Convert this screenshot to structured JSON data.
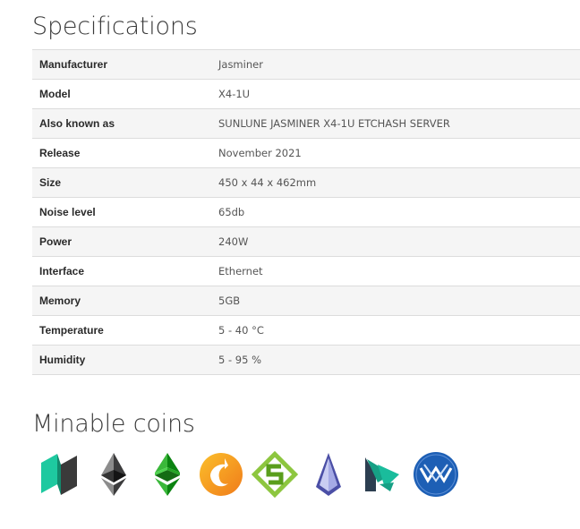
{
  "specifications": {
    "title": "Specifications",
    "rows": [
      {
        "key": "Manufacturer",
        "value": "Jasminer"
      },
      {
        "key": "Model",
        "value": "X4-1U"
      },
      {
        "key": "Also known as",
        "value": "SUNLUNE JASMINER X4-1U ETCHASH SERVER"
      },
      {
        "key": "Release",
        "value": "November 2021"
      },
      {
        "key": "Size",
        "value": "450 x 44 x 462mm"
      },
      {
        "key": "Noise level",
        "value": "65db"
      },
      {
        "key": "Power",
        "value": "240W"
      },
      {
        "key": "Interface",
        "value": "Ethernet"
      },
      {
        "key": "Memory",
        "value": "5GB"
      },
      {
        "key": "Temperature",
        "value": "5 - 40 °C"
      },
      {
        "key": "Humidity",
        "value": "5 - 95 %"
      }
    ]
  },
  "minable_coins": {
    "title": "Minable coins",
    "coins": [
      {
        "icon": "ubiq-icon",
        "colors": [
          "#1ec9a0",
          "#3a3a3a"
        ]
      },
      {
        "icon": "ethereum-icon",
        "colors": [
          "#3c3c3d",
          "#8c8c8c"
        ]
      },
      {
        "icon": "ethereum-classic-icon",
        "colors": [
          "#3ab83a",
          "#0b8311"
        ]
      },
      {
        "icon": "callisto-icon",
        "colors": [
          "#f5a623",
          "#f07b1a"
        ]
      },
      {
        "icon": "soilcoin-icon",
        "colors": [
          "#8dc63f",
          "#5a9e1c"
        ]
      },
      {
        "icon": "expanse-icon",
        "colors": [
          "#4b4fa6",
          "#c9cdf2"
        ]
      },
      {
        "icon": "metaverse-icon",
        "colors": [
          "#16a085",
          "#2c3e50"
        ]
      },
      {
        "icon": "musicoin-icon",
        "colors": [
          "#1d5fb5",
          "#ffffff"
        ]
      }
    ]
  }
}
